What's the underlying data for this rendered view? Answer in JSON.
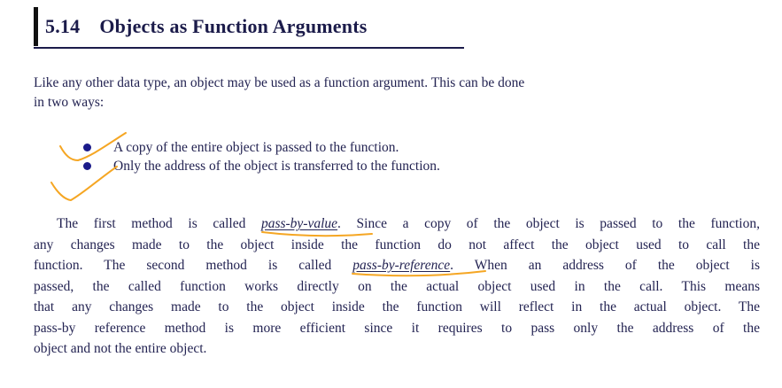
{
  "section": {
    "number": "5.14",
    "title": "Objects as Function Arguments"
  },
  "intro": {
    "line1": "Like any other data type,  an object may be used as a function argument. This can be done",
    "line2": "in two ways:"
  },
  "bullets": [
    "A copy of the entire object is passed to the function.",
    "Only the address of the object is transferred to the function."
  ],
  "paragraph": {
    "l1_pre": "The first method is called ",
    "l1_term": "pass-by-value",
    "l1_post": ". Since a copy of the object is passed to the function,",
    "l2": "any changes made to the object inside the function do not affect the object used to call the",
    "l3_pre": "function. The second method is called ",
    "l3_term": "pass-by-reference",
    "l3_post": ". When an address of the object is",
    "l4": "passed, the called  function works directly on the actual object used in the call. This means",
    "l5": "that any changes made to the object inside the function will reflect in the actual object. The",
    "l6": "pass-by reference method is more efficient since it requires to pass only the address of the",
    "l7": "object and not the entire object."
  },
  "annotations": {
    "ink_color": "#f5a623"
  }
}
